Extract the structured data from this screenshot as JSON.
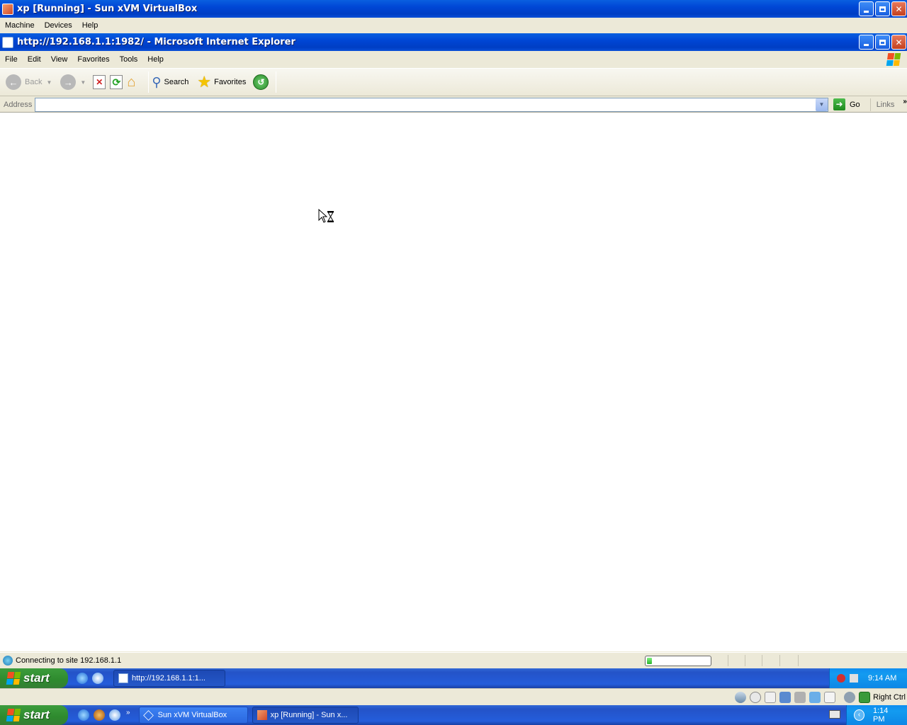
{
  "vbox_window": {
    "title": "xp [Running] - Sun xVM VirtualBox",
    "menu": [
      "Machine",
      "Devices",
      "Help"
    ]
  },
  "ie_window": {
    "title": "http://192.168.1.1:1982/ - Microsoft Internet Explorer",
    "menu": [
      "File",
      "Edit",
      "View",
      "Favorites",
      "Tools",
      "Help"
    ],
    "toolbar": {
      "back_label": "Back",
      "search_label": "Search",
      "favorites_label": "Favorites"
    },
    "address": {
      "label": "Address",
      "value": "",
      "go_label": "Go",
      "links_label": "Links"
    },
    "status": {
      "text": "Connecting to site 192.168.1.1",
      "progress": 0.08
    }
  },
  "guest_taskbar": {
    "start_label": "start",
    "tasks": [
      "http://192.168.1.1:1..."
    ],
    "clock": "9:14 AM"
  },
  "vbox_statusbar": {
    "host_key_label": "Right Ctrl"
  },
  "host_taskbar": {
    "start_label": "start",
    "tasks": [
      "Sun xVM VirtualBox",
      "xp [Running] - Sun x..."
    ],
    "clock": "1:14 PM"
  },
  "colors": {
    "xp_blue": "#0046d5",
    "start_green": "#2e8a2e",
    "tray_blue": "#139bf0",
    "close_red": "#c3401f"
  }
}
